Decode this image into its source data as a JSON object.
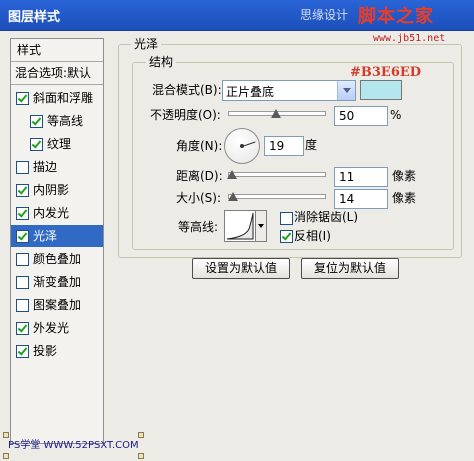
{
  "window": {
    "title": "图层样式",
    "watermark_left": "思缘设计",
    "watermark_brand": "脚本之家",
    "watermark_url": "www.jb51.net"
  },
  "sidebar": {
    "header": "样式",
    "blend_options": "混合选项:默认",
    "items": [
      {
        "label": "斜面和浮雕",
        "checked": true
      },
      {
        "label": "等高线",
        "checked": true
      },
      {
        "label": "纹理",
        "checked": true
      },
      {
        "label": "描边",
        "checked": false
      },
      {
        "label": "内阴影",
        "checked": true
      },
      {
        "label": "内发光",
        "checked": true
      },
      {
        "label": "光泽",
        "checked": true,
        "selected": true
      },
      {
        "label": "颜色叠加",
        "checked": false
      },
      {
        "label": "渐变叠加",
        "checked": false
      },
      {
        "label": "图案叠加",
        "checked": false
      },
      {
        "label": "外发光",
        "checked": true
      },
      {
        "label": "投影",
        "checked": true
      }
    ]
  },
  "satin": {
    "section_title": "光泽",
    "structure_title": "结构",
    "blend_mode_label": "混合模式(B):",
    "blend_mode_value": "正片叠底",
    "color_hex_label": "#B3E6ED",
    "color": "#B3E6ED",
    "opacity_label": "不透明度(O):",
    "opacity_value": "50",
    "opacity_unit": "%",
    "opacity_level": 0.5,
    "angle_label": "角度(N):",
    "angle_value": "19",
    "angle_unit": "度",
    "distance_label": "距离(D):",
    "distance_value": "11",
    "distance_unit": "像素",
    "distance_level": 0.045,
    "size_label": "大小(S):",
    "size_value": "14",
    "size_unit": "像素",
    "size_level": 0.056,
    "contour_label": "等高线:",
    "antialias_label": "消除锯齿(L)",
    "antialias_checked": false,
    "invert_label": "反相(I)",
    "invert_checked": true
  },
  "buttons": {
    "set_default": "设置为默认值",
    "reset_default": "复位为默认值"
  },
  "footer_watermark": "PS学堂 WWW.52PSXT.COM"
}
